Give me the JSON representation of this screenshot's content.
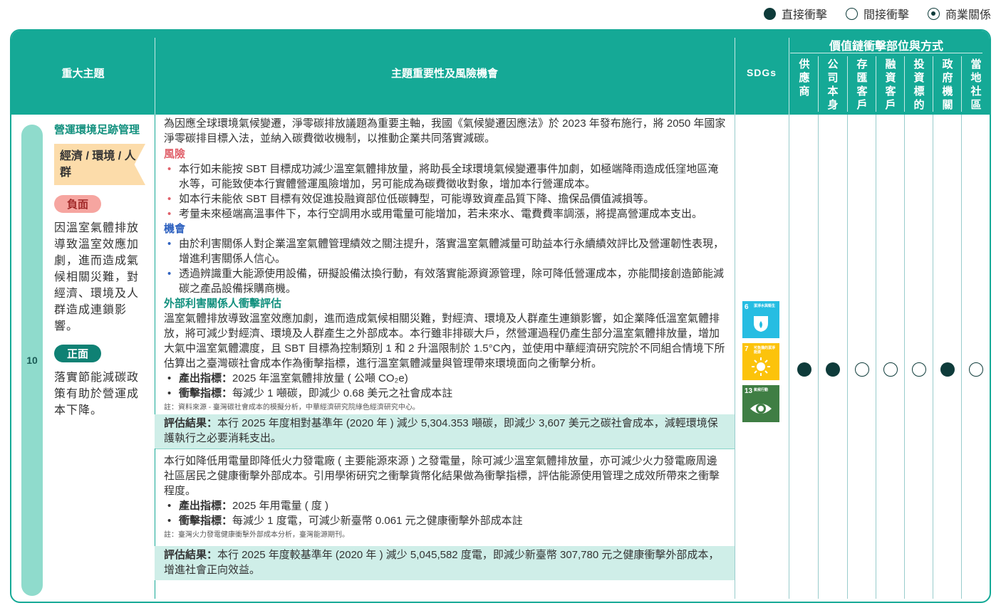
{
  "legend": [
    {
      "label": "直接衝擊",
      "kind": "filled"
    },
    {
      "label": "間接衝擊",
      "kind": "hollow"
    },
    {
      "label": "商業關係",
      "kind": "ringed"
    }
  ],
  "header": {
    "col_topic": "重大主題",
    "col_content": "主題重要性及風險機會",
    "col_sdgs": "SDGs",
    "value_chain_title": "價值鏈衝擊部位與方式",
    "value_chain_cols": [
      "供應商",
      "公司本身",
      "存匯客戶",
      "融資客戶",
      "投資標的",
      "政府機關",
      "當地社區"
    ]
  },
  "row": {
    "number": "10",
    "topic_title": "營運環境足跡管理",
    "topic_tag": "經濟 / 環境 / 人群",
    "negative_label": "負面",
    "negative_text": "因溫室氣體排放導致溫室效應加劇，進而造成氣候相關災難，對經濟、環境及人群造成連鎖影響。",
    "positive_label": "正面",
    "positive_text": "落實節能減碳政策有助於營運成本下降。",
    "intro": "為因應全球環境氣候變遷，淨零碳排放議題為重要主軸，我國《氣候變遷因應法》於 2023 年發布施行，將 2050 年國家淨零碳排目標入法，並納入碳費徵收機制，以推動企業共同落實減碳。",
    "risk_heading": "風險",
    "risks": [
      "本行如未能按 SBT 目標成功減少溫室氣體排放量，將助長全球環境氣候變遷事件加劇，如極端降雨造成低窪地區淹水等，可能致使本行實體營運風險增加，另可能成為碳費徵收對象，增加本行營運成本。",
      "如本行未能依 SBT 目標有效促進投融資部位低碳轉型，可能導致資產品質下降、擔保品價值減損等。",
      "考量未來極端高溫事件下，本行空調用水或用電量可能增加，若未來水、電費費率調漲，將提高營運成本支出。"
    ],
    "opportunity_heading": "機會",
    "opportunities": [
      "由於利害關係人對企業溫室氣體管理績效之關注提升，落實溫室氣體減量可助益本行永續績效評比及營運韌性表現，增進利害關係人信心。",
      "透過辨識重大能源使用設備，研擬設備汰換行動，有效落實能源資源管理，除可降低營運成本，亦能間接創造節能減碳之產品設備採購商機。"
    ],
    "external_heading": "外部利害關係人衝擊評估",
    "external_text": "溫室氣體排放導致溫室效應加劇，進而造成氣候相關災難，對經濟、環境及人群產生連鎖影響，如企業降低溫室氣體排放，將可減少對經濟、環境及人群產生之外部成本。本行雖非排碳大戶，然營運過程仍產生部分溫室氣體排放量，增加大氣中溫室氣體濃度，且 SBT 目標為控制類別 1 和 2 升溫限制於 1.5°C內，並使用中華經濟研究院於不同組合情境下所估算出之臺灣碳社會成本作為衝擊指標，進行溫室氣體減量與管理帶來環境面向之衝擊分析。",
    "block1": {
      "output_label": "產出指標：",
      "output_text": "2025 年溫室氣體排放量 ( 公噸 CO₂e)",
      "impact_label": "衝擊指標：",
      "impact_text": "每減少 1 噸碳，即減少 0.68 美元之社會成本註",
      "note": "註：資料來源 - 臺灣碳社會成本的模擬分析，中華經濟研究院綠色經濟研究中心。",
      "result_label": "評估結果：",
      "result_text": "本行 2025 年度相對基準年 (2020 年 ) 減少 5,304.353 噸碳，即減少 3,607 美元之碳社會成本，減輕環境保護執行之必要消耗支出。"
    },
    "block2": {
      "intro": "本行如降低用電量即降低火力發電廠 ( 主要能源來源 ) 之發電量，除可減少溫室氣體排放量，亦可減少火力發電廠周邊社區居民之健康衝擊外部成本。引用學術研究之衝擊貨幣化結果做為衝擊指標，評估能源使用管理之成效所帶來之衝擊程度。",
      "output_label": "產出指標：",
      "output_text": "2025 年用電量 ( 度 )",
      "impact_label": "衝擊指標：",
      "impact_text": "每減少 1 度電，可減少新臺幣 0.061 元之健康衝擊外部成本註",
      "note": "註：臺灣火力發電健康衝擊外部成本分析，臺灣能源期刊。",
      "result_label": "評估結果：",
      "result_text": "本行 2025 年度較基準年 (2020 年 ) 減少 5,045,582 度電，即減少新臺幣 307,780 元之健康衝擊外部成本，增進社會正向效益。"
    },
    "sdgs": [
      {
        "number": "6",
        "title": "潔淨水與衛生",
        "color": "#26bde2",
        "icon": "water-icon"
      },
      {
        "number": "7",
        "title": "可負擔的潔淨能源",
        "color": "#fcc30b",
        "icon": "sun-icon"
      },
      {
        "number": "13",
        "title": "氣候行動",
        "color": "#3f7e44",
        "icon": "eye-globe-icon"
      }
    ],
    "impacts": [
      "filled",
      "filled",
      "hollow",
      "hollow",
      "hollow",
      "filled",
      "hollow"
    ]
  },
  "colors": {
    "header": "#15a996",
    "accent_dark": "#0e3b3a",
    "risk": "#e0606a",
    "opportunity": "#2f62c0",
    "result_bg": "#cfeee8"
  }
}
